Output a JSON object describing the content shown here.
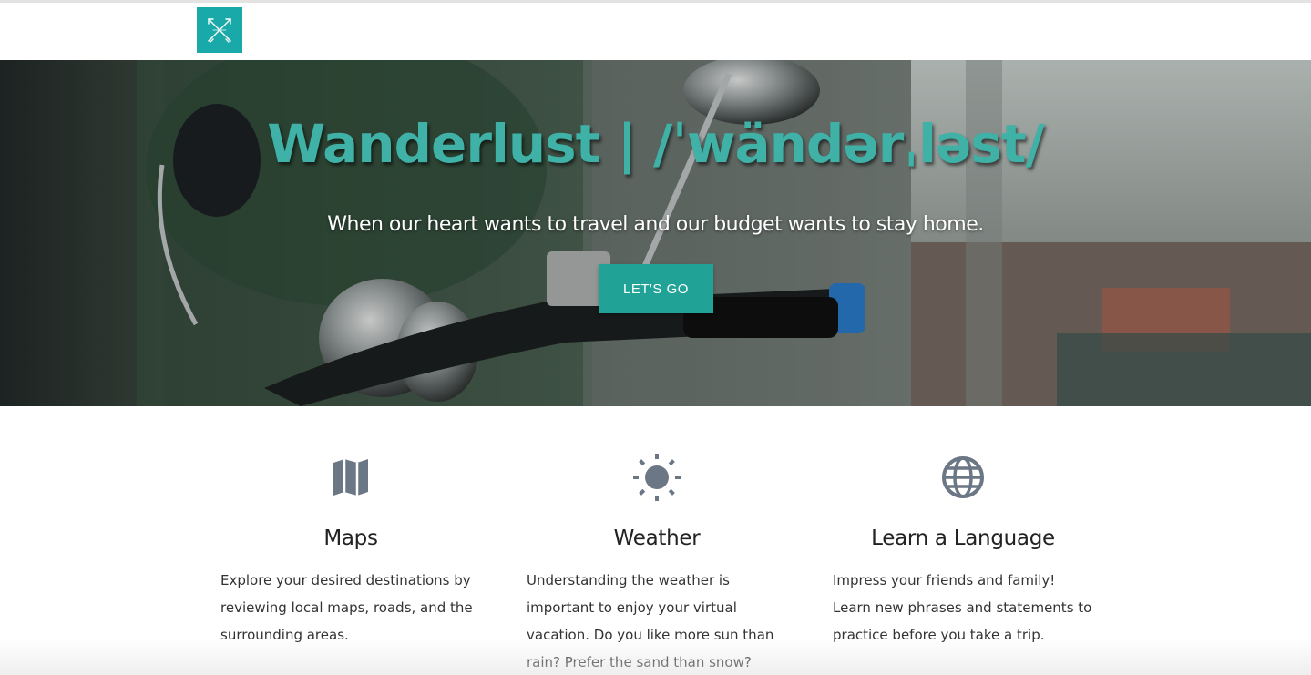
{
  "nav": {
    "logo_icon": "crossed-arrows-icon",
    "logo_color": "#1aa9a9"
  },
  "hero": {
    "title": "Wanderlust | /ˈwändərˌləst/",
    "subtitle": "When our heart wants to travel and our budget wants to stay home.",
    "cta_label": "LET'S GO",
    "title_color": "#3fb1a6",
    "cta_color": "#20a296"
  },
  "features": [
    {
      "icon": "map-icon",
      "title": "Maps",
      "text": "Explore your desired destinations by reviewing local maps, roads, and the surrounding areas."
    },
    {
      "icon": "sun-icon",
      "title": "Weather",
      "text": "Understanding the weather is important to enjoy your virtual vacation. Do you like more sun than rain? Prefer the sand than snow? Mountains or beaches?"
    },
    {
      "icon": "globe-icon",
      "title": "Learn a Language",
      "text": "Impress your friends and family! Learn new phrases and statements to practice before you take a trip."
    }
  ],
  "icon_color": "#6b7785"
}
